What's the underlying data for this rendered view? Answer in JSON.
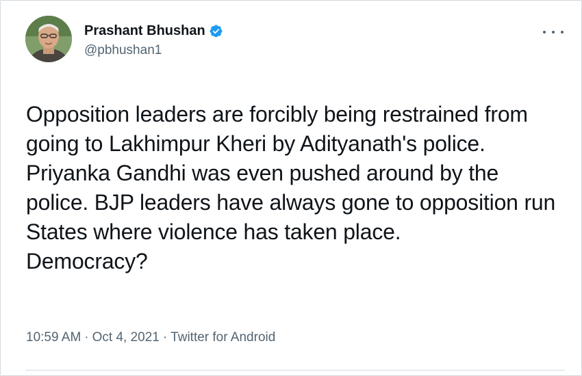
{
  "author": {
    "display_name": "Prashant Bhushan",
    "handle": "@pbhushan1",
    "verified": true,
    "verified_color": "#1d9bf0"
  },
  "tweet": {
    "lines": [
      "Opposition leaders are forcibly being restrained from",
      "going to Lakhimpur Kheri by Adityanath's police.",
      "Priyanka Gandhi was even pushed around by the",
      "police. BJP leaders have always gone to opposition run",
      "States where violence has taken place.",
      "Democracy?"
    ]
  },
  "meta": {
    "time": "10:59 AM",
    "separator": "·",
    "date": "Oct 4, 2021",
    "source": "Twitter for Android"
  },
  "icons": {
    "more": "more-horizontal-icon",
    "verified": "verified-badge-icon"
  },
  "colors": {
    "text_primary": "#0f1419",
    "text_secondary": "#536471",
    "border": "#cfd9de"
  }
}
